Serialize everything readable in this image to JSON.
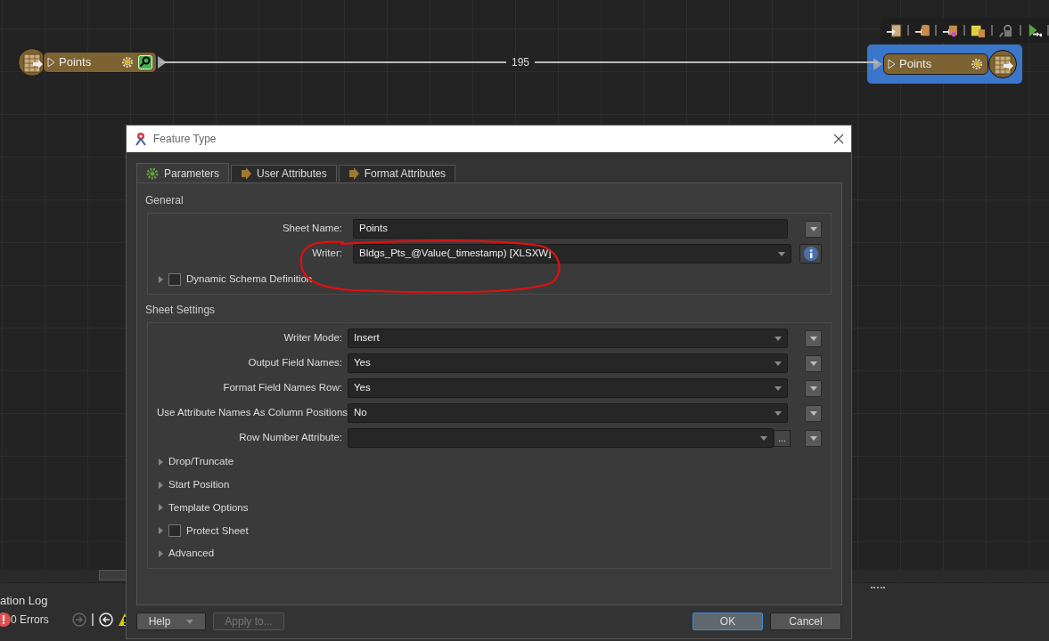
{
  "canvas": {
    "nodes": [
      {
        "label": "Points",
        "kind": "reader",
        "selected": false
      },
      {
        "label": "Points",
        "kind": "writer",
        "selected": true
      }
    ],
    "connection": {
      "count": "195"
    }
  },
  "log_panel": {
    "title": "ation Log",
    "errors": "0 Errors"
  },
  "dialog": {
    "title": "Feature Type",
    "tabs": [
      {
        "label": "Parameters",
        "kind": "gear",
        "selected": true
      },
      {
        "label": "User Attributes",
        "kind": "arrow",
        "selected": false
      },
      {
        "label": "Format Attributes",
        "kind": "arrow",
        "selected": false
      }
    ],
    "sections": [
      {
        "title": "General",
        "rows": [
          {
            "kind": "text",
            "label": "Sheet Name:",
            "value": "Points",
            "side": {
              "kind": "dropdown"
            }
          },
          {
            "kind": "select",
            "label": "Writer:",
            "value": "Bldgs_Pts_@Value(_timestamp) [XLSXW]",
            "side": {
              "kind": "info"
            },
            "circled": true
          },
          {
            "kind": "checkbox",
            "label": "Dynamic Schema Definition",
            "checked": false,
            "expanded": false
          }
        ]
      },
      {
        "title": "Sheet Settings",
        "rows": [
          {
            "kind": "select",
            "label": "Writer Mode:",
            "value": "Insert",
            "side": {
              "kind": "dropdown"
            }
          },
          {
            "kind": "select",
            "label": "Output Field Names:",
            "value": "Yes",
            "side": {
              "kind": "dropdown"
            }
          },
          {
            "kind": "select",
            "label": "Format Field Names Row:",
            "value": "Yes",
            "side": {
              "kind": "dropdown"
            }
          },
          {
            "kind": "select",
            "label": "Use Attribute Names As Column Positions:",
            "value": "No",
            "side": {
              "kind": "dropdown"
            }
          },
          {
            "kind": "combo",
            "label": "Row Number Attribute:",
            "browse": "...",
            "side": {
              "kind": "dropdown"
            }
          },
          {
            "kind": "group",
            "label": "Drop/Truncate",
            "expanded": false
          },
          {
            "kind": "group",
            "label": "Start Position",
            "expanded": false
          },
          {
            "kind": "group",
            "label": "Template Options",
            "expanded": false
          },
          {
            "kind": "checkbox",
            "label": "Protect Sheet",
            "checked": false,
            "expanded": false
          },
          {
            "kind": "group",
            "label": "Advanced",
            "expanded": false
          }
        ]
      }
    ],
    "buttons": [
      {
        "label": "Help",
        "kind": "menu",
        "disabled": false,
        "default": false
      },
      {
        "label": "Apply to...",
        "kind": "plain",
        "disabled": true,
        "default": false
      },
      {
        "label": "OK",
        "kind": "plain",
        "disabled": false,
        "default": true
      },
      {
        "label": "Cancel",
        "kind": "plain",
        "disabled": false,
        "default": false
      }
    ]
  }
}
